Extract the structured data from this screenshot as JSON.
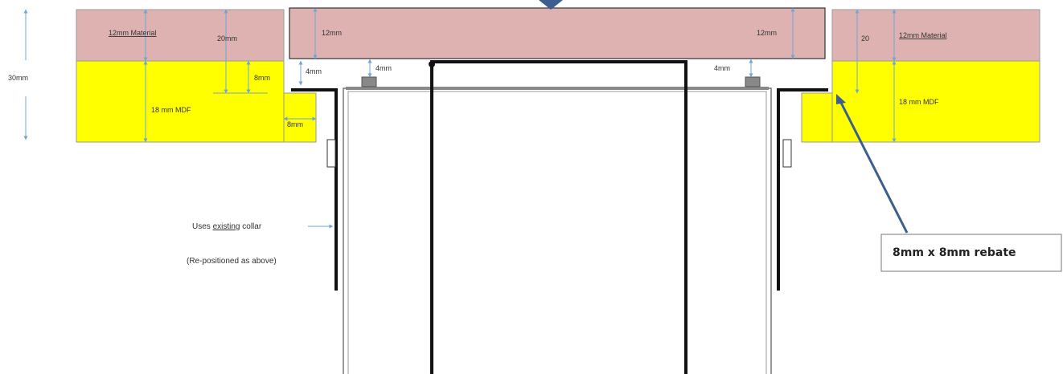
{
  "diagram": {
    "dimensions": {
      "overall_height": "30mm",
      "left_material": "12mm Material",
      "left_total": "20mm",
      "left_rebate_depth": "8mm",
      "left_mdf": "18 mm MDF",
      "left_rebate_width": "8mm",
      "left_gap": "4mm",
      "center_left": "12mm",
      "center_right": "12mm",
      "center_gap_left": "4mm",
      "center_gap_right": "4mm",
      "right_total": "20",
      "right_material": "12mm Material",
      "right_mdf": "18 mm MDF"
    },
    "notes": {
      "collar_prefix": "Uses",
      "collar_underlined": "existing",
      "collar_suffix": "collar",
      "collar_line2": "(Re-positioned as above)"
    },
    "callout": "8mm x 8mm rebate",
    "colors": {
      "material": "#dfb2b2",
      "mdf": "#ffff00",
      "dimension": "#6fa6d6",
      "arrow": "#3c5f8f",
      "outline": "#555555"
    }
  }
}
